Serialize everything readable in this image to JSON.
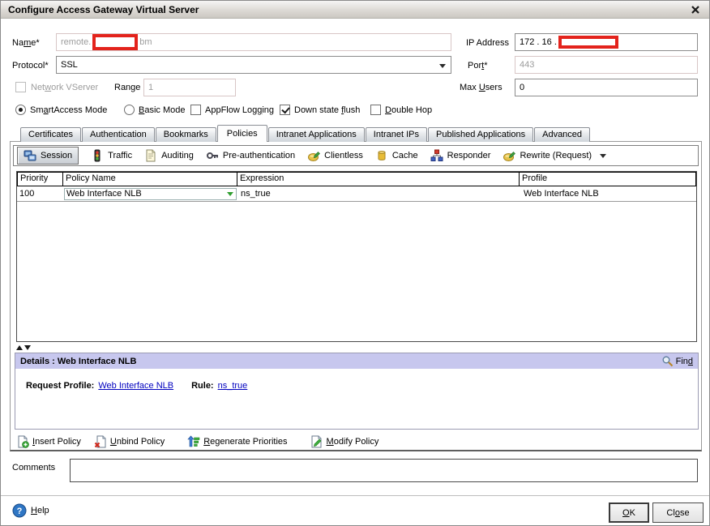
{
  "window": {
    "title": "Configure Access Gateway Virtual Server"
  },
  "colors": {
    "redaction": "#e3231c",
    "details_header": "#c7c7ee",
    "link": "#0000bf"
  },
  "form": {
    "name": {
      "label": "Na[m]e*",
      "value_prefix": "remote.",
      "value_suffix": "bm",
      "redacted": true
    },
    "ip_address": {
      "label": "IP Address",
      "value": "172 . 16  .",
      "redacted": true
    },
    "protocol": {
      "label": "Protocol*",
      "value": "SSL"
    },
    "port": {
      "label": "Por[t]*",
      "value": "443"
    },
    "network_vserver": {
      "label": "Net[w]ork VServer",
      "checked": false
    },
    "range": {
      "label": "Range",
      "value": "1"
    },
    "max_users": {
      "label": "Max [U]sers",
      "value": "0"
    },
    "smartaccess_mode": {
      "label": "Sm[a]rtAccess Mode",
      "selected": true
    },
    "basic_mode": {
      "label": "[B]asic Mode",
      "selected": false
    },
    "appflow_logging": {
      "label": "AppFlow Log[g]ing",
      "checked": false
    },
    "down_state_flush": {
      "label": "Down state [f]lush",
      "checked": true
    },
    "double_hop": {
      "label": "[D]ouble Hop",
      "checked": false
    }
  },
  "tabs": {
    "items": [
      "Certificates",
      "Authentication",
      "Bookmarks",
      "Policies",
      "Intranet Applications",
      "Intranet IPs",
      "Published Applications",
      "Advanced"
    ],
    "active": "Policies"
  },
  "policy_toolbar": {
    "items": [
      {
        "label": "Session",
        "icon": "session-icon",
        "selected": true
      },
      {
        "label": "Traffic",
        "icon": "traffic-light-icon",
        "selected": false
      },
      {
        "label": "Auditing",
        "icon": "document-icon",
        "selected": false
      },
      {
        "label": "Pre-authentication",
        "icon": "key-icon",
        "selected": false
      },
      {
        "label": "Clientless",
        "icon": "pencil-badge-icon",
        "selected": false
      },
      {
        "label": "Cache",
        "icon": "cache-jar-icon",
        "selected": false
      },
      {
        "label": "Responder",
        "icon": "blocks-icon",
        "selected": false
      },
      {
        "label": "Rewrite (Request)",
        "icon": "pencil-badge-icon",
        "selected": false,
        "has_dropdown": true
      }
    ]
  },
  "policy_table": {
    "columns": [
      "Priority",
      "Policy Name",
      "Expression",
      "Profile"
    ],
    "rows": [
      {
        "priority": "100",
        "policy_name": "Web Interface NLB",
        "expression": "ns_true",
        "profile": "Web Interface NLB"
      }
    ]
  },
  "details": {
    "title": "Details : Web Interface NLB",
    "find_label": "Fin[d]",
    "request_profile_label": "Request Profile:",
    "request_profile_value": "Web Interface NLB",
    "rule_label": "Rule:",
    "rule_value": "ns_true"
  },
  "actions": {
    "items": [
      {
        "label": "[I]nsert Policy",
        "icon": "insert-policy-icon"
      },
      {
        "label": "[U]nbind Policy",
        "icon": "unbind-policy-icon"
      },
      {
        "label": "[R]egenerate Priorities",
        "icon": "regenerate-priorities-icon"
      },
      {
        "label": "[M]odify Policy",
        "icon": "modify-policy-icon"
      }
    ]
  },
  "comments": {
    "label": "Comments",
    "value": ""
  },
  "footer": {
    "help_label": "[H]elp",
    "help_icon_glyph": "?",
    "ok_label": "[O]K",
    "close_label": "Cl[o]se"
  }
}
